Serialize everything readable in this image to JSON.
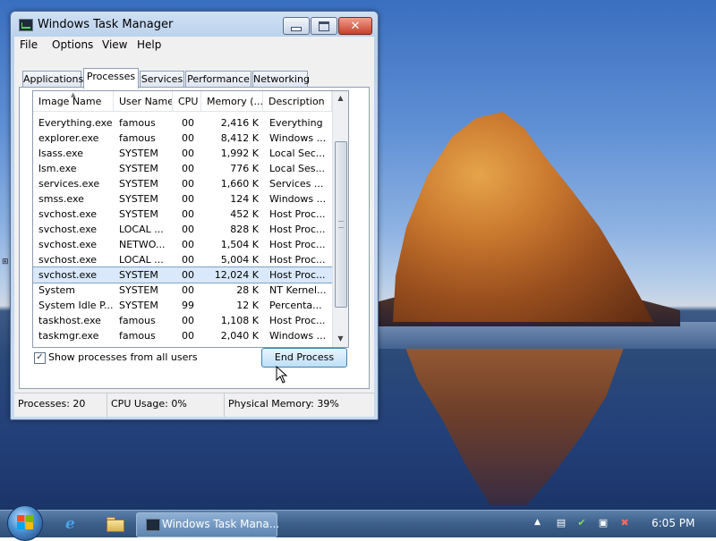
{
  "window": {
    "title": "Windows Task Manager"
  },
  "menu": [
    "File",
    "Options",
    "View",
    "Help"
  ],
  "tabs": [
    "Applications",
    "Processes",
    "Services",
    "Performance",
    "Networking"
  ],
  "active_tab": "Processes",
  "columns": [
    "Image Name",
    "User Name",
    "CPU",
    "Memory (...",
    "Description"
  ],
  "processes": [
    {
      "name": "Everything.exe",
      "user": "famous",
      "cpu": "00",
      "mem": "2,416 K",
      "desc": "Everything"
    },
    {
      "name": "explorer.exe",
      "user": "famous",
      "cpu": "00",
      "mem": "8,412 K",
      "desc": "Windows ..."
    },
    {
      "name": "lsass.exe",
      "user": "SYSTEM",
      "cpu": "00",
      "mem": "1,992 K",
      "desc": "Local Sec..."
    },
    {
      "name": "lsm.exe",
      "user": "SYSTEM",
      "cpu": "00",
      "mem": "776 K",
      "desc": "Local Ses..."
    },
    {
      "name": "services.exe",
      "user": "SYSTEM",
      "cpu": "00",
      "mem": "1,660 K",
      "desc": "Services ..."
    },
    {
      "name": "smss.exe",
      "user": "SYSTEM",
      "cpu": "00",
      "mem": "124 K",
      "desc": "Windows ..."
    },
    {
      "name": "svchost.exe",
      "user": "SYSTEM",
      "cpu": "00",
      "mem": "452 K",
      "desc": "Host Proc..."
    },
    {
      "name": "svchost.exe",
      "user": "LOCAL ...",
      "cpu": "00",
      "mem": "828 K",
      "desc": "Host Proc..."
    },
    {
      "name": "svchost.exe",
      "user": "NETWO...",
      "cpu": "00",
      "mem": "1,504 K",
      "desc": "Host Proc..."
    },
    {
      "name": "svchost.exe",
      "user": "LOCAL ...",
      "cpu": "00",
      "mem": "5,004 K",
      "desc": "Host Proc..."
    },
    {
      "name": "svchost.exe",
      "user": "SYSTEM",
      "cpu": "00",
      "mem": "12,024 K",
      "desc": "Host Proc...",
      "selected": true
    },
    {
      "name": "System",
      "user": "SYSTEM",
      "cpu": "00",
      "mem": "28 K",
      "desc": "NT Kernel..."
    },
    {
      "name": "System Idle P...",
      "user": "SYSTEM",
      "cpu": "99",
      "mem": "12 K",
      "desc": "Percenta..."
    },
    {
      "name": "taskhost.exe",
      "user": "famous",
      "cpu": "00",
      "mem": "1,108 K",
      "desc": "Host Proc..."
    },
    {
      "name": "taskmgr.exe",
      "user": "famous",
      "cpu": "00",
      "mem": "2,040 K",
      "desc": "Windows ..."
    }
  ],
  "show_all_users": {
    "label": "Show processes from all users",
    "checked": true
  },
  "end_process_label": "End Process",
  "status": {
    "processes": "Processes: 20",
    "cpu": "CPU Usage: 0%",
    "memory": "Physical Memory: 39%"
  },
  "taskbar": {
    "task_label": "Windows Task Mana...",
    "clock": "6:05 PM"
  },
  "icons": {
    "app": "task-manager-icon",
    "ie": "internet-explorer-icon",
    "explorer": "folder-icon",
    "start": "windows-logo-icon"
  },
  "colors": {
    "selection": "#d9e8fb",
    "close_button": "#c6402a",
    "taskbar": "#3c5f8a"
  }
}
